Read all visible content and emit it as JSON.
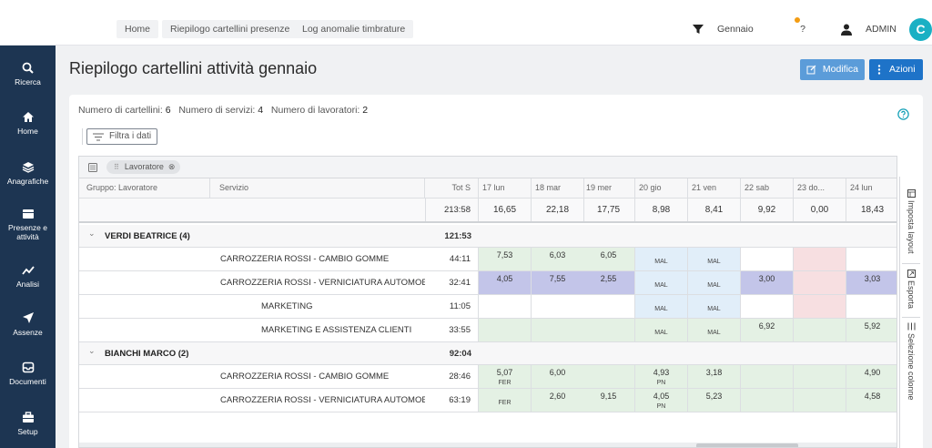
{
  "topnav": {
    "tabs": [
      "Home",
      "Riepilogo cartellini presenze",
      "Log anomalie timbrature"
    ],
    "filter_label": "Gennaio",
    "help_label": "?",
    "user_label": "ADMIN",
    "refresh_label": "C"
  },
  "sidebar": {
    "items": [
      {
        "label": "Ricerca",
        "icon": "search-icon"
      },
      {
        "label": "Home",
        "icon": "home-icon"
      },
      {
        "label": "Anagrafiche",
        "icon": "layers-icon"
      },
      {
        "label": "Presenze e attività",
        "icon": "calendar-icon"
      },
      {
        "label": "Analisi",
        "icon": "chart-line-icon"
      },
      {
        "label": "Assenze",
        "icon": "plane-icon"
      },
      {
        "label": "Documenti",
        "icon": "inbox-icon"
      },
      {
        "label": "Setup",
        "icon": "briefcase-icon"
      }
    ]
  },
  "header": {
    "title": "Riepilogo cartellini attività gennaio",
    "modifica_label": "Modifica",
    "azioni_label": "Azioni"
  },
  "summary": {
    "cartellini_label": "Numero di cartellini:",
    "cartellini_value": "6",
    "servizi_label": "Numero di servizi:",
    "servizi_value": "4",
    "lavoratori_label": "Numero di lavoratori:",
    "lavoratori_value": "2"
  },
  "filter_label": "Filtra i dati",
  "group_chip": "Lavoratore",
  "table": {
    "columns": {
      "gruppo": "Gruppo: Lavoratore",
      "servizio": "Servizio",
      "tot": "Tot S",
      "days": [
        "17 lun",
        "18 mar",
        "19 mer",
        "20 gio",
        "21 ven",
        "22 sab",
        "23 do...",
        "24 lun"
      ]
    },
    "totals": {
      "tot": "213:58",
      "days": [
        "16,65",
        "22,18",
        "17,75",
        "8,98",
        "8,41",
        "9,92",
        "0,00",
        "18,43"
      ]
    },
    "rows": [
      {
        "type": "group",
        "label": "VERDI BEATRICE (4)",
        "tot": "121:53"
      },
      {
        "type": "item",
        "indent": 1,
        "servizio": "CARROZZERIA ROSSI - CAMBIO GOMME",
        "tot": "44:11",
        "days": [
          {
            "v": "7,53"
          },
          {
            "v": "6,03"
          },
          {
            "v": "6,05"
          },
          {
            "sub": "MAL"
          },
          {
            "sub": "MAL"
          },
          {},
          {},
          {}
        ]
      },
      {
        "type": "item",
        "indent": 1,
        "servizio": "CARROZZERIA ROSSI - VERNICIATURA AUTOMOBI...",
        "tot": "32:41",
        "days": [
          {
            "v": "4,05"
          },
          {
            "v": "7,55"
          },
          {
            "v": "2,55"
          },
          {
            "sub": "MAL"
          },
          {
            "sub": "MAL"
          },
          {
            "v": "3,00"
          },
          {},
          {
            "v": "3,03"
          }
        ]
      },
      {
        "type": "item",
        "indent": 2,
        "servizio": "MARKETING",
        "tot": "11:05",
        "days": [
          {},
          {},
          {},
          {
            "sub": "MAL"
          },
          {
            "sub": "MAL"
          },
          {},
          {},
          {}
        ]
      },
      {
        "type": "item",
        "indent": 2,
        "servizio": "MARKETING E ASSISTENZA CLIENTI",
        "tot": "33:55",
        "days": [
          {},
          {},
          {},
          {
            "sub": "MAL"
          },
          {
            "sub": "MAL"
          },
          {
            "v": "6,92"
          },
          {},
          {
            "v": "5,92"
          }
        ]
      },
      {
        "type": "group",
        "label": "BIANCHI MARCO (2)",
        "tot": "92:04"
      },
      {
        "type": "item",
        "indent": 1,
        "servizio": "CARROZZERIA ROSSI - CAMBIO GOMME",
        "tot": "28:46",
        "days": [
          {
            "v": "5,07",
            "sub": "FER"
          },
          {
            "v": "6,00"
          },
          {},
          {
            "v": "4,93",
            "sub": "PN"
          },
          {
            "v": "3,18"
          },
          {},
          {},
          {
            "v": "4,90"
          }
        ]
      },
      {
        "type": "item",
        "indent": 1,
        "servizio": "CARROZZERIA ROSSI - VERNICIATURA AUTOMOBI...",
        "tot": "63:19",
        "days": [
          {
            "sub": "FER"
          },
          {
            "v": "2,60"
          },
          {
            "v": "9,15"
          },
          {
            "v": "4,05",
            "sub": "PN"
          },
          {
            "v": "5,23"
          },
          {},
          {},
          {
            "v": "4,58"
          }
        ]
      }
    ]
  },
  "tool_panel": [
    "Imposta layout",
    "Esporta",
    "Selezione colonne"
  ],
  "colors": {
    "sidebar": "#1d3552",
    "primary": "#1e73c8",
    "green_cell": "#e4f1e4",
    "blue_cell": "#e1eef9",
    "purple_row": "#c3c5e9",
    "pink_cell": "#f7dfe1",
    "accent_orange": "#f39c12",
    "refresh": "#1ab0c4"
  }
}
